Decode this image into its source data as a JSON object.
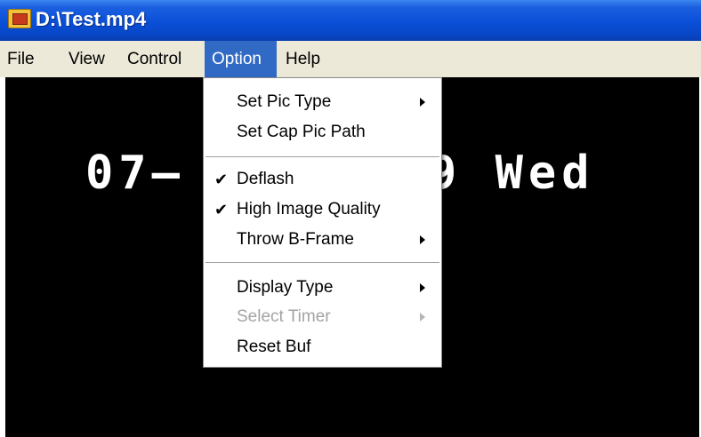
{
  "window": {
    "title": "D:\\Test.mp4"
  },
  "menubar": {
    "items": [
      {
        "label": "File"
      },
      {
        "label": "View"
      },
      {
        "label": "Control"
      },
      {
        "label": "Option"
      },
      {
        "label": "Help"
      }
    ]
  },
  "video": {
    "osd_left": "07—",
    "osd_right": "9 Wed"
  },
  "option_menu": {
    "items": [
      {
        "label": "Set Pic Type",
        "submenu": true
      },
      {
        "label": "Set Cap Pic Path"
      },
      {
        "label": "Deflash",
        "checked": true
      },
      {
        "label": "High Image Quality",
        "checked": true
      },
      {
        "label": "Throw B-Frame",
        "submenu": true
      },
      {
        "label": "Display Type",
        "submenu": true
      },
      {
        "label": "Select Timer",
        "submenu": true,
        "disabled": true
      },
      {
        "label": "Reset Buf"
      }
    ],
    "check_glyph": "✔"
  }
}
